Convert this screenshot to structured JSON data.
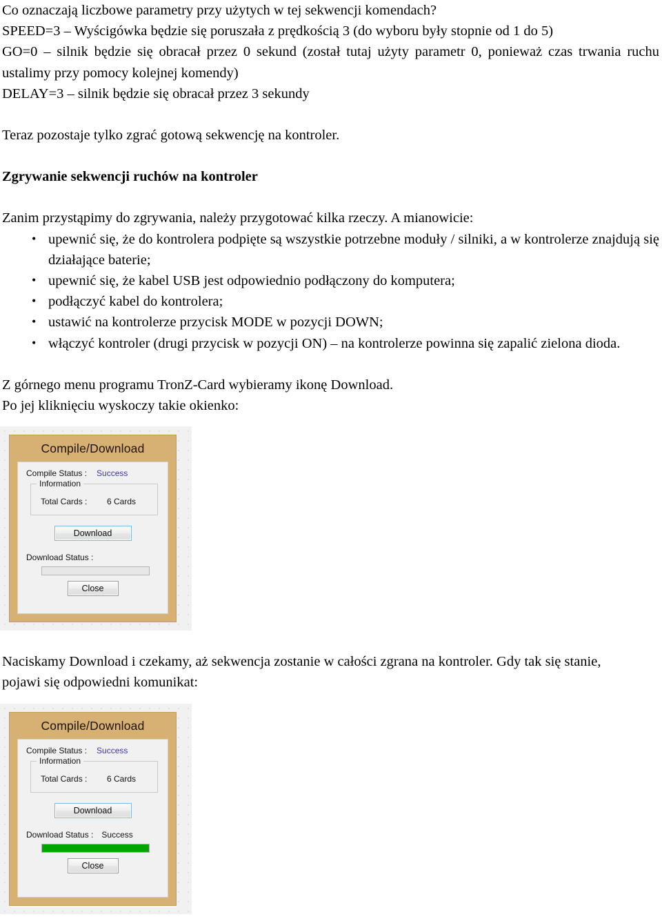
{
  "document": {
    "paragraphs_top": [
      "Co oznaczają liczbowe parametry przy użytych w tej sekwencji komendach?",
      "SPEED=3 – Wyścigówka będzie się poruszała z prędkością 3 (do wyboru były stopnie od 1 do 5)",
      "GO=0 – silnik będzie się obracał przez 0 sekund (został tutaj użyty parametr 0, ponieważ czas trwania ruchu ustalimy przy pomocy kolejnej komendy)",
      "DELAY=3 – silnik będzie się obracał przez 3 sekundy"
    ],
    "paragraph_after_gap": "Teraz pozostaje tylko zgrać gotową sekwencję na kontroler.",
    "heading": "Zgrywanie sekwencji ruchów na kontroler",
    "intro": "Zanim przystąpimy do zgrywania, należy przygotować kilka rzeczy. A mianowicie:",
    "bullet_mark": "•",
    "bullets": [
      "upewnić się, że do kontrolera podpięte są wszystkie potrzebne moduły / silniki, a w kontrolerze znajdują się działające baterie;",
      "upewnić się, że kabel USB jest odpowiednio podłączony do komputera;",
      "podłączyć kabel do kontrolera;",
      "ustawić na kontrolerze przycisk MODE w pozycji DOWN;",
      "włączyć kontroler (drugi przycisk w pozycji ON) – na kontrolerze powinna się zapalić zielona dioda."
    ],
    "after_bullets_1": "Z górnego menu programu TronZ-Card wybieramy ikonę Download.",
    "after_bullets_2": "Po jej kliknięciu wyskoczy takie okienko:",
    "after_first_dialog_1": "Naciskamy Download i czekamy, aż sekwencja zostanie w całości zgrana na kontroler. Gdy tak się stanie,",
    "after_first_dialog_2": "pojawi się odpowiedni komunikat:"
  },
  "dialog_before": {
    "title": "Compile/Download",
    "compile_status_label": "Compile Status :",
    "compile_status_value": "Success",
    "information_legend": "Information",
    "total_cards_label": "Total Cards :",
    "total_cards_value": "6 Cards",
    "download_button": "Download",
    "download_status_label": "Download Status :",
    "download_status_value": "",
    "progress_percent": 0,
    "close_button": "Close"
  },
  "dialog_after": {
    "title": "Compile/Download",
    "compile_status_label": "Compile Status :",
    "compile_status_value": "Success",
    "information_legend": "Information",
    "total_cards_label": "Total Cards :",
    "total_cards_value": "6 Cards",
    "download_button": "Download",
    "download_status_label": "Download Status :",
    "download_status_value": "Success",
    "progress_percent": 100,
    "close_button": "Close"
  },
  "colors": {
    "dialog_frame": "#d7b173",
    "dialog_body": "#f1f1f1",
    "status_text": "#3a39a8",
    "progress_fill": "#01a401",
    "focus_border": "#8ab6d6"
  }
}
